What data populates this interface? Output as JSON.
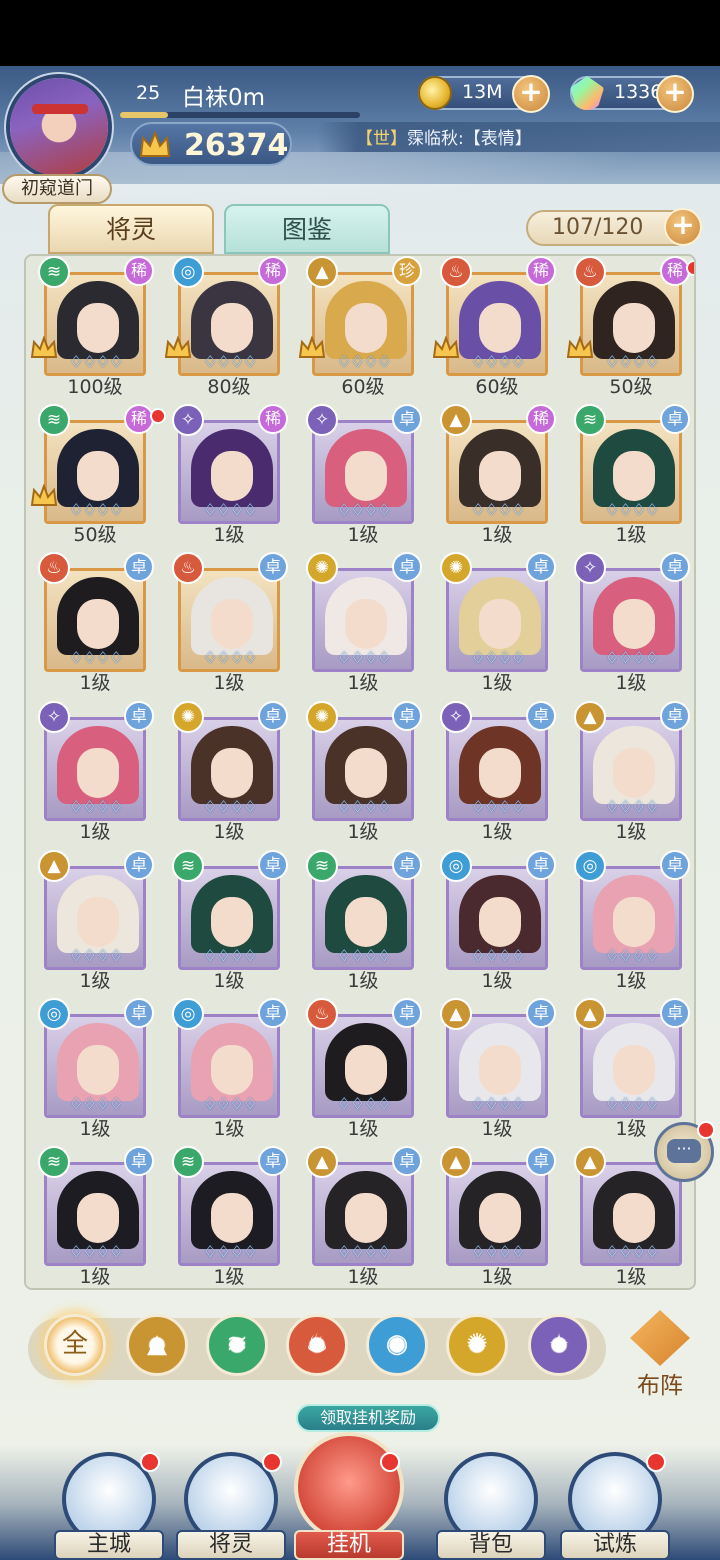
{
  "player": {
    "level": "25",
    "name": "白袜0m",
    "power": "26374",
    "rank": "初窥道门",
    "exp_fraction": 0.2
  },
  "resources": {
    "gold": "13M",
    "gems": "1336"
  },
  "chat": {
    "channel": "【世】",
    "message": "霂临秋:【表情】"
  },
  "tabs": {
    "heroes": "将灵",
    "codex": "图鉴"
  },
  "capacity": "107/120",
  "heroes": [
    {
      "level": "100级",
      "element": "wind",
      "rarity": "稀",
      "frame": "gold",
      "crown": true,
      "hair": "#2a2a30"
    },
    {
      "level": "80级",
      "element": "water",
      "rarity": "稀",
      "frame": "gold",
      "crown": true,
      "hair": "#3a3540"
    },
    {
      "level": "60级",
      "element": "earth",
      "rarity": "珍",
      "frame": "gold",
      "crown": true,
      "hair": "#d9a94e"
    },
    {
      "level": "60级",
      "element": "fire",
      "rarity": "稀",
      "frame": "gold",
      "crown": true,
      "hair": "#6a4fa6"
    },
    {
      "level": "50级",
      "element": "fire",
      "rarity": "稀",
      "frame": "gold",
      "crown": true,
      "hair": "#2f2420",
      "dot": true
    },
    {
      "level": "50级",
      "element": "wind",
      "rarity": "稀",
      "frame": "gold",
      "crown": true,
      "hair": "#1f2233",
      "dot": true
    },
    {
      "level": "1级",
      "element": "dark",
      "rarity": "稀",
      "frame": "purple",
      "crown": false,
      "hair": "#4a2c6e"
    },
    {
      "level": "1级",
      "element": "dark",
      "rarity": "卓",
      "frame": "purple",
      "crown": false,
      "hair": "#d8607e"
    },
    {
      "level": "1级",
      "element": "earth",
      "rarity": "稀",
      "frame": "gold",
      "crown": false,
      "hair": "#3a2e28"
    },
    {
      "level": "1级",
      "element": "wind",
      "rarity": "卓",
      "frame": "gold",
      "crown": false,
      "hair": "#1f4a40"
    },
    {
      "level": "1级",
      "element": "fire",
      "rarity": "卓",
      "frame": "gold",
      "crown": false,
      "hair": "#1f1c20"
    },
    {
      "level": "1级",
      "element": "fire",
      "rarity": "卓",
      "frame": "gold",
      "crown": false,
      "hair": "#e8e4e0"
    },
    {
      "level": "1级",
      "element": "light",
      "rarity": "卓",
      "frame": "purple",
      "crown": false,
      "hair": "#efe8e4"
    },
    {
      "level": "1级",
      "element": "light",
      "rarity": "卓",
      "frame": "purple",
      "crown": false,
      "hair": "#e3cf9a"
    },
    {
      "level": "1级",
      "element": "dark",
      "rarity": "卓",
      "frame": "purple",
      "crown": false,
      "hair": "#d8607e"
    },
    {
      "level": "1级",
      "element": "dark",
      "rarity": "卓",
      "frame": "purple",
      "crown": false,
      "hair": "#d8607e"
    },
    {
      "level": "1级",
      "element": "light",
      "rarity": "卓",
      "frame": "purple",
      "crown": false,
      "hair": "#4a3228"
    },
    {
      "level": "1级",
      "element": "light",
      "rarity": "卓",
      "frame": "purple",
      "crown": false,
      "hair": "#4a3228"
    },
    {
      "level": "1级",
      "element": "dark",
      "rarity": "卓",
      "frame": "purple",
      "crown": false,
      "hair": "#6e3426"
    },
    {
      "level": "1级",
      "element": "earth",
      "rarity": "卓",
      "frame": "purple",
      "crown": false,
      "hair": "#ece6dc"
    },
    {
      "level": "1级",
      "element": "earth",
      "rarity": "卓",
      "frame": "purple",
      "crown": false,
      "hair": "#ece6dc"
    },
    {
      "level": "1级",
      "element": "wind",
      "rarity": "卓",
      "frame": "purple",
      "crown": false,
      "hair": "#1f4a40"
    },
    {
      "level": "1级",
      "element": "wind",
      "rarity": "卓",
      "frame": "purple",
      "crown": false,
      "hair": "#1f4a40"
    },
    {
      "level": "1级",
      "element": "water",
      "rarity": "卓",
      "frame": "purple",
      "crown": false,
      "hair": "#4a2a2e"
    },
    {
      "level": "1级",
      "element": "water",
      "rarity": "卓",
      "frame": "purple",
      "crown": false,
      "hair": "#e8a2b2"
    },
    {
      "level": "1级",
      "element": "water",
      "rarity": "卓",
      "frame": "purple",
      "crown": false,
      "hair": "#e8a2b2"
    },
    {
      "level": "1级",
      "element": "water",
      "rarity": "卓",
      "frame": "purple",
      "crown": false,
      "hair": "#e8a2b2"
    },
    {
      "level": "1级",
      "element": "fire",
      "rarity": "卓",
      "frame": "purple",
      "crown": false,
      "hair": "#1f1c20"
    },
    {
      "level": "1级",
      "element": "earth",
      "rarity": "卓",
      "frame": "purple",
      "crown": false,
      "hair": "#e8e8ec"
    },
    {
      "level": "1级",
      "element": "earth",
      "rarity": "卓",
      "frame": "purple",
      "crown": false,
      "hair": "#e8e8ec"
    },
    {
      "level": "1级",
      "element": "wind",
      "rarity": "卓",
      "frame": "purple",
      "crown": false,
      "hair": "#1c1c22"
    },
    {
      "level": "1级",
      "element": "wind",
      "rarity": "卓",
      "frame": "purple",
      "crown": false,
      "hair": "#1c1c22"
    },
    {
      "level": "1级",
      "element": "earth",
      "rarity": "卓",
      "frame": "purple",
      "crown": false,
      "hair": "#262326"
    },
    {
      "level": "1级",
      "element": "earth",
      "rarity": "卓",
      "frame": "purple",
      "crown": false,
      "hair": "#262326"
    },
    {
      "level": "1级",
      "element": "earth",
      "rarity": "卓",
      "frame": "purple",
      "crown": false,
      "hair": "#262326"
    }
  ],
  "filters": {
    "all": "全",
    "items": [
      "earth",
      "wind",
      "fire",
      "water",
      "light",
      "dark"
    ]
  },
  "formation": "布阵",
  "collect_reward": "领取挂机奖励",
  "nav": {
    "city": "主城",
    "heroes": "将灵",
    "idle": "挂机",
    "bag": "背包",
    "trial": "试炼"
  },
  "colors": {
    "wind": "#3aa86a",
    "water": "#3f9dd6",
    "earth": "#c99432",
    "fire": "#d85a3c",
    "light": "#d4a72a",
    "dark": "#7b62b8"
  }
}
